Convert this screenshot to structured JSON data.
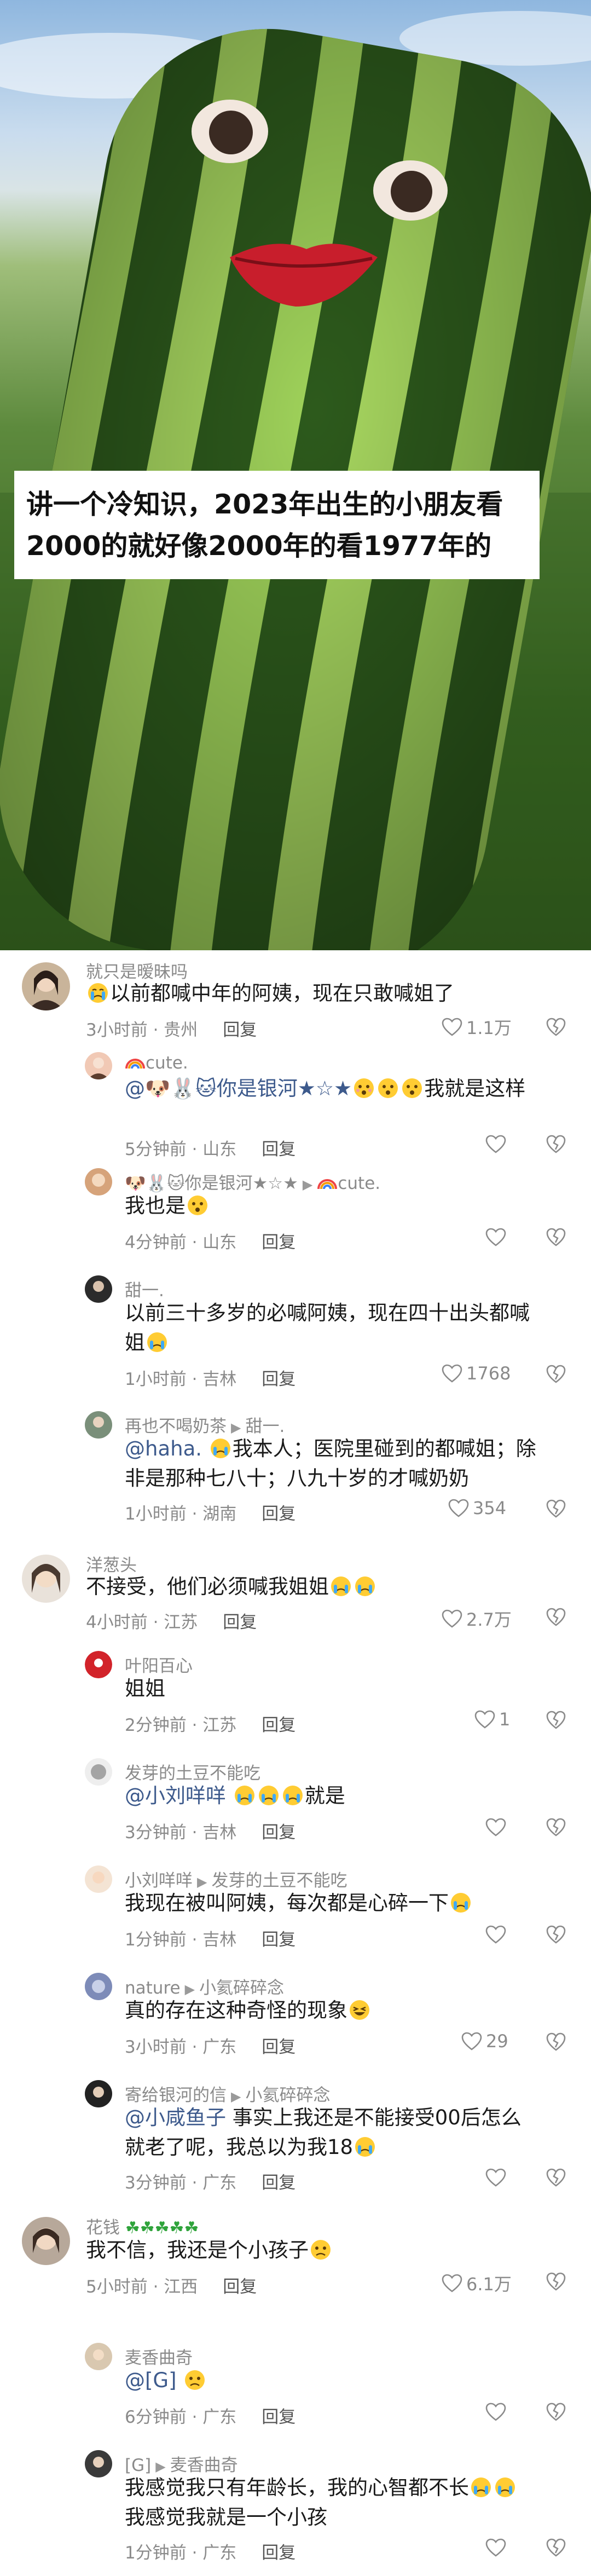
{
  "video": {
    "caption_line1": "讲一个冷知识，2023年出生的小朋友看",
    "caption_line2": "2000的就好像2000年的看1977年的"
  },
  "colors": {
    "mention": "#3d5a8c",
    "meta": "#8a8a8a",
    "watermelon_dark": "#2d5a1c",
    "watermelon_light": "#9fd25a"
  },
  "comments": [
    {
      "user": "就只是暧昧吗",
      "text": "以前都喊中年的阿姨，现在只敢喊姐了",
      "time": "3小时前 · 贵州",
      "reply": "回复",
      "likes": "1.1万"
    },
    {
      "user": "cute.",
      "mention": "@🐶🐰🐱你是银河★☆★",
      "text": "我就是这样",
      "time": "5分钟前 · 山东",
      "reply": "回复",
      "likes": ""
    },
    {
      "user": "🐶🐰🐱你是银河★☆★",
      "reply_to": "cute.",
      "text": "我也是",
      "time": "4分钟前 · 山东",
      "reply": "回复",
      "likes": ""
    },
    {
      "user": "甜一.",
      "text_line1": "以前三十多岁的必喊阿姨，现在四十出头都喊",
      "text_line2": "姐",
      "time": "1小时前 · 吉林",
      "reply": "回复",
      "likes": "1768"
    },
    {
      "user": "再也不喝奶茶",
      "reply_to": "甜一.",
      "mention": "@haha.",
      "text_line1": "我本人；医院里碰到的都喊姐；除",
      "text_line2": "非是那种七八十；八九十岁的才喊奶奶",
      "time": "1小时前 · 湖南",
      "reply": "回复",
      "likes": "354"
    },
    {
      "user": "洋葱头",
      "text": "不接受，他们必须喊我姐姐",
      "time": "4小时前 · 江苏",
      "reply": "回复",
      "likes": "2.7万"
    },
    {
      "user": "叶阳百心",
      "text": "姐姐",
      "time": "2分钟前 · 江苏",
      "reply": "回复",
      "likes": "1"
    },
    {
      "user": "发芽的土豆不能吃",
      "mention": "@小刘咩咩",
      "text": "就是",
      "time": "3分钟前 · 吉林",
      "reply": "回复",
      "likes": ""
    },
    {
      "user": "小刘咩咩",
      "reply_to": "发芽的土豆不能吃",
      "text": "我现在被叫阿姨，每次都是心碎一下",
      "time": "1分钟前 · 吉林",
      "reply": "回复",
      "likes": ""
    },
    {
      "user": "nature",
      "reply_to": "小氦碎碎念",
      "text": "真的存在这种奇怪的现象",
      "time": "3小时前 · 广东",
      "reply": "回复",
      "likes": "29"
    },
    {
      "user": "寄给银河的信",
      "reply_to": "小氦碎碎念",
      "mention": "@小咸鱼子",
      "text_line1": "事实上我还是不能接受00后怎么",
      "text_line2": "就老了呢，我总以为我18",
      "time": "3分钟前 · 广东",
      "reply": "回复",
      "likes": ""
    },
    {
      "user": "花钱",
      "text": "我不信，我还是个小孩子",
      "time": "5小时前 · 江西",
      "reply": "回复",
      "likes": "6.1万"
    },
    {
      "user": "麦香曲奇",
      "mention": "@[G]",
      "text": "",
      "time": "6分钟前 · 广东",
      "reply": "回复",
      "likes": ""
    },
    {
      "user": "[G]",
      "reply_to": "麦香曲奇",
      "text_line1": "我感觉我只有年龄长，我的心智都不长",
      "text_line2": "我感觉我就是一个小孩",
      "time": "1分钟前 · 广东",
      "reply": "回复",
      "likes": ""
    }
  ]
}
